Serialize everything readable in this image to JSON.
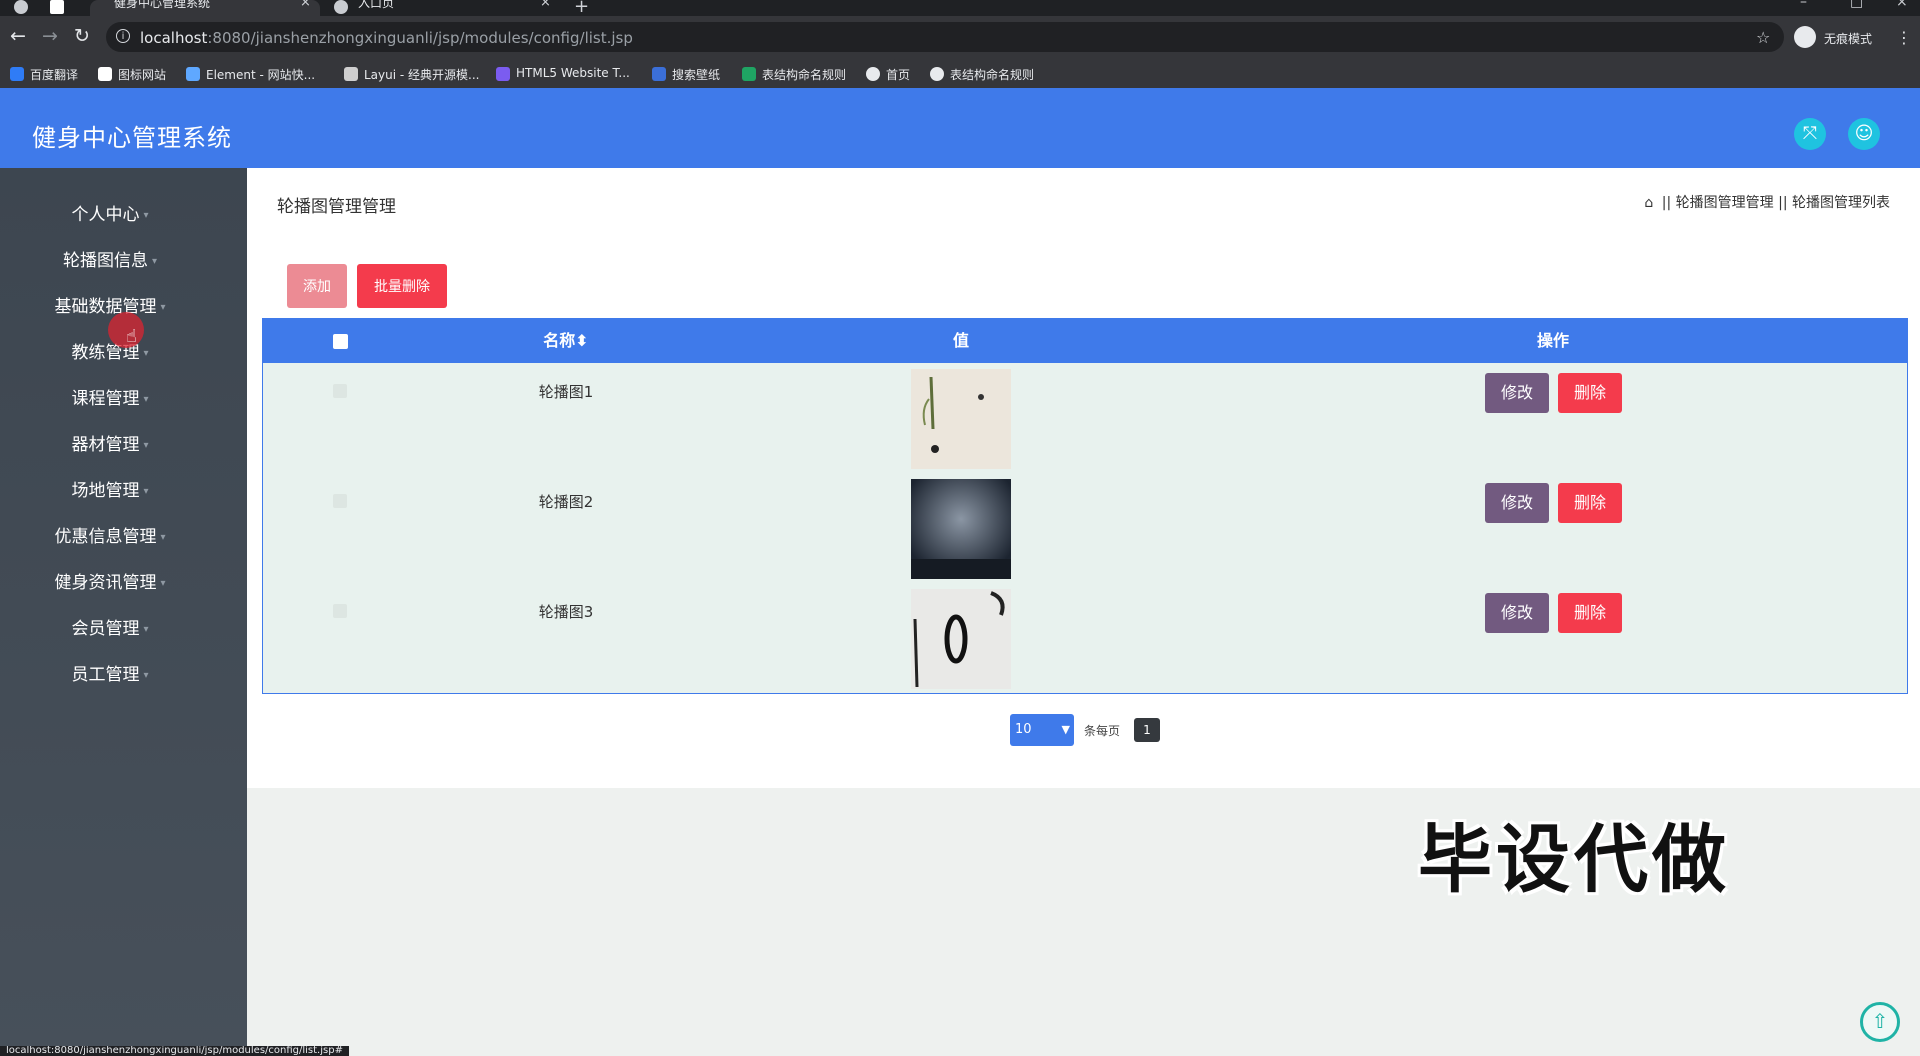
{
  "browser": {
    "tabs": [
      {
        "title": "健身中心管理系统",
        "active": true
      },
      {
        "title": "入口页",
        "active": false
      }
    ],
    "url_host": "localhost",
    "url_rest": ":8080/jianshenzhongxinguanli/jsp/modules/config/list.jsp",
    "incognito_label": "无痕模式",
    "bookmarks": [
      "百度翻译",
      "图标网站",
      "Element - 网站快...",
      "Layui - 经典开源模...",
      "HTML5 Website T...",
      "搜索壁纸",
      "表结构命名规则",
      "首页",
      "表结构命名规则"
    ],
    "status_url": "localhost:8080/jianshenzhongxinguanli/jsp/modules/config/list.jsp#"
  },
  "app": {
    "title": "健身中心管理系统"
  },
  "sidebar": {
    "items": [
      "个人中心",
      "轮播图信息",
      "基础数据管理",
      "教练管理",
      "课程管理",
      "器材管理",
      "场地管理",
      "优惠信息管理",
      "健身资讯管理",
      "会员管理",
      "员工管理"
    ],
    "caret": "▾"
  },
  "main": {
    "title": "轮播图管理管理",
    "breadcrumb": {
      "sep": "||",
      "items": [
        "轮播图管理管理",
        "轮播图管理列表"
      ]
    },
    "buttons": {
      "add": "添加",
      "batch_delete": "批量删除"
    },
    "table": {
      "columns": [
        "名称",
        "值",
        "操作"
      ],
      "sort_icon": "⬍",
      "rows": [
        {
          "name": "轮播图1"
        },
        {
          "name": "轮播图2"
        },
        {
          "name": "轮播图3"
        }
      ],
      "edit_label": "修改",
      "delete_label": "删除"
    },
    "pagination": {
      "page_size": "10",
      "per_page_label": "条每页",
      "current_page": "1"
    }
  },
  "watermark": "毕设代做",
  "colors": {
    "primary": "#3f7aea",
    "danger": "#f43b4c",
    "edit": "#725a80",
    "cyan": "#1fc3e0"
  }
}
